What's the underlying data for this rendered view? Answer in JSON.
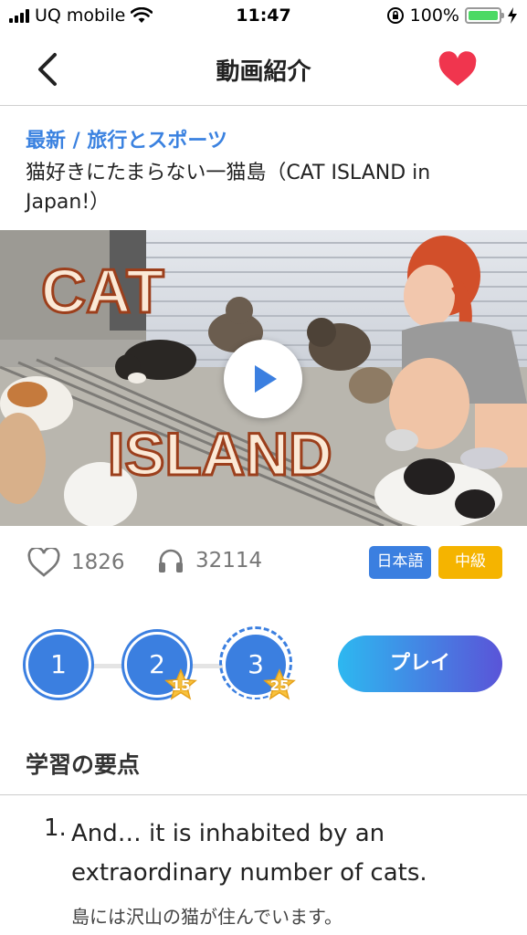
{
  "status_bar": {
    "carrier": "UQ mobile",
    "time": "11:47",
    "battery": "100%",
    "battery_level": 1.0
  },
  "nav": {
    "title": "動画紹介",
    "back_icon": "chevron-left-icon",
    "favorite_icon": "heart-icon",
    "favorite_color": "#f0354e"
  },
  "video": {
    "category": "最新 / 旅行とスポーツ",
    "title": "猫好きにたまらない一猫島（CAT ISLAND in Japan!）",
    "thumbnail_text_1": "CAT",
    "thumbnail_text_2": "ISLAND",
    "likes": "1826",
    "listens": "32114",
    "language_tag": "日本語",
    "level_tag": "中級",
    "language_tag_color": "#3b7fe0",
    "level_tag_color": "#f5b400"
  },
  "steps": [
    {
      "label": "1",
      "badge": ""
    },
    {
      "label": "2",
      "badge": "15"
    },
    {
      "label": "3",
      "badge": "25"
    }
  ],
  "play_label": "プレイ",
  "points_section": {
    "title": "学習の要点",
    "items": [
      {
        "number": "1.",
        "english": "And… it is inhabited by an extraordinary number of cats.",
        "japanese": "島には沢山の猫が住んでいます。"
      }
    ]
  },
  "colors": {
    "accent": "#3b7fe0",
    "category": "#3b82e0"
  }
}
